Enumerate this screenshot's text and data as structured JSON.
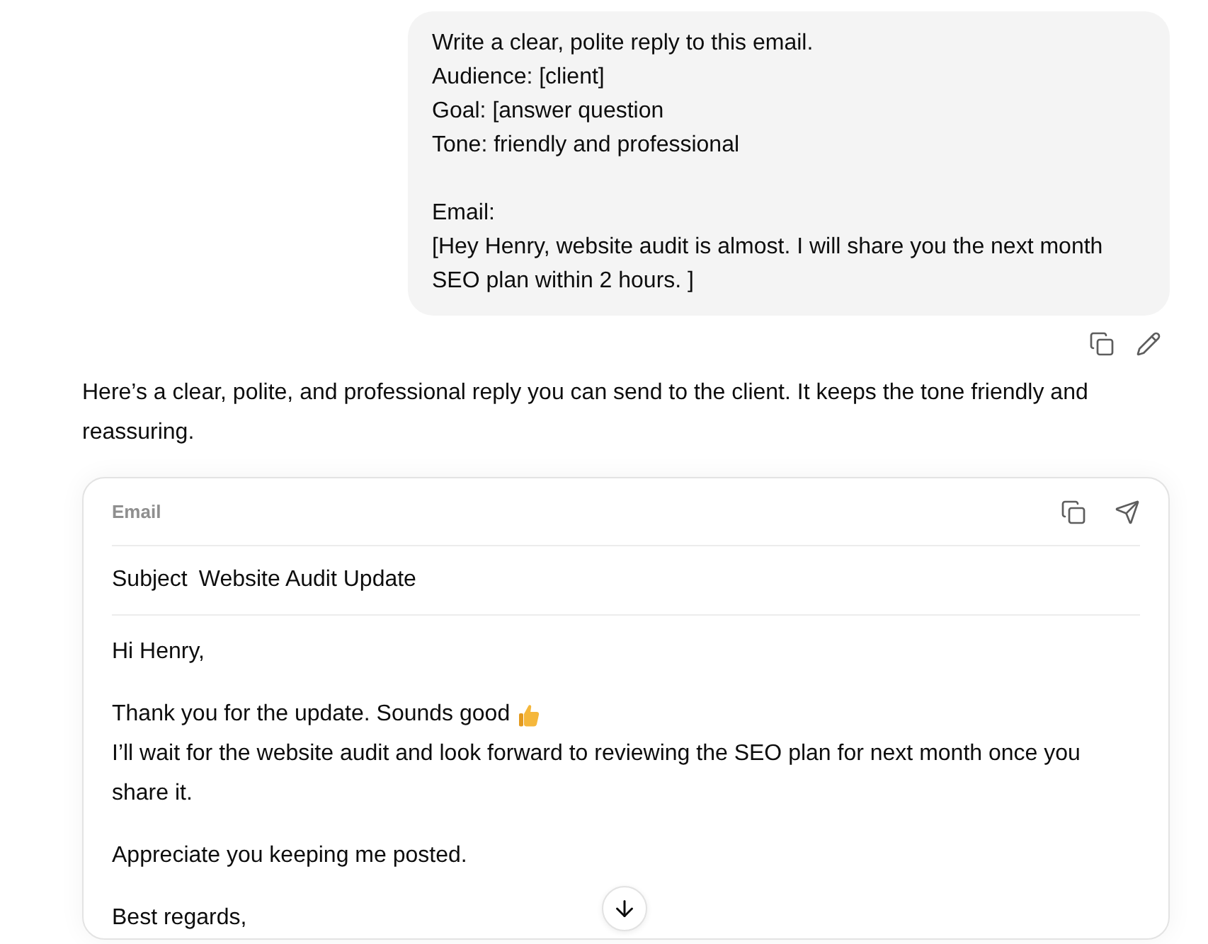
{
  "user_message": {
    "paragraphs": [
      [
        "Write a clear, polite reply to this email.",
        "Audience: [client]",
        "Goal: [answer question",
        "Tone: friendly and professional"
      ],
      [
        "Email:",
        "[Hey Henry, website audit is almost. I will share you the next month SEO plan within 2 hours. ]"
      ]
    ]
  },
  "assistant_message": {
    "text": "Here’s a clear, polite, and professional reply you can send to the client. It keeps the tone friendly and reassuring."
  },
  "email_card": {
    "label": "Email",
    "subject_label": "Subject",
    "subject": "Website Audit Update",
    "body": [
      [
        {
          "text": "Hi Henry,",
          "emoji": false
        }
      ],
      [
        {
          "text": "Thank you for the update. Sounds good",
          "emoji": true
        },
        {
          "text": "I’ll wait for the website audit and look forward to reviewing the SEO plan for next month once you share it.",
          "emoji": false
        }
      ],
      [
        {
          "text": "Appreciate you keeping me posted.",
          "emoji": false
        }
      ],
      [
        {
          "text": "Best regards,",
          "emoji": false
        }
      ]
    ]
  }
}
